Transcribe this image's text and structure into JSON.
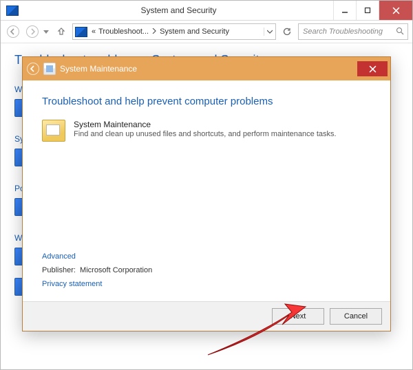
{
  "parent_window": {
    "title": "System and Security",
    "breadcrumb": {
      "root": "«",
      "part1": "Troubleshoot...",
      "part2": "System and Security"
    },
    "search_placeholder": "Search Troubleshooting",
    "page_heading": "Troubleshoot problems - System and Security",
    "sections": [
      {
        "label": "Web"
      },
      {
        "label": "System"
      },
      {
        "label": "Power"
      },
      {
        "label": "Windows"
      }
    ]
  },
  "wizard": {
    "title": "System Maintenance",
    "heading": "Troubleshoot and help prevent computer problems",
    "item_title": "System Maintenance",
    "item_desc": "Find and clean up unused files and shortcuts, and perform maintenance tasks.",
    "advanced_link": "Advanced",
    "publisher_label": "Publisher:",
    "publisher_value": "Microsoft Corporation",
    "privacy_link": "Privacy statement",
    "next_label": "Next",
    "cancel_label": "Cancel"
  }
}
